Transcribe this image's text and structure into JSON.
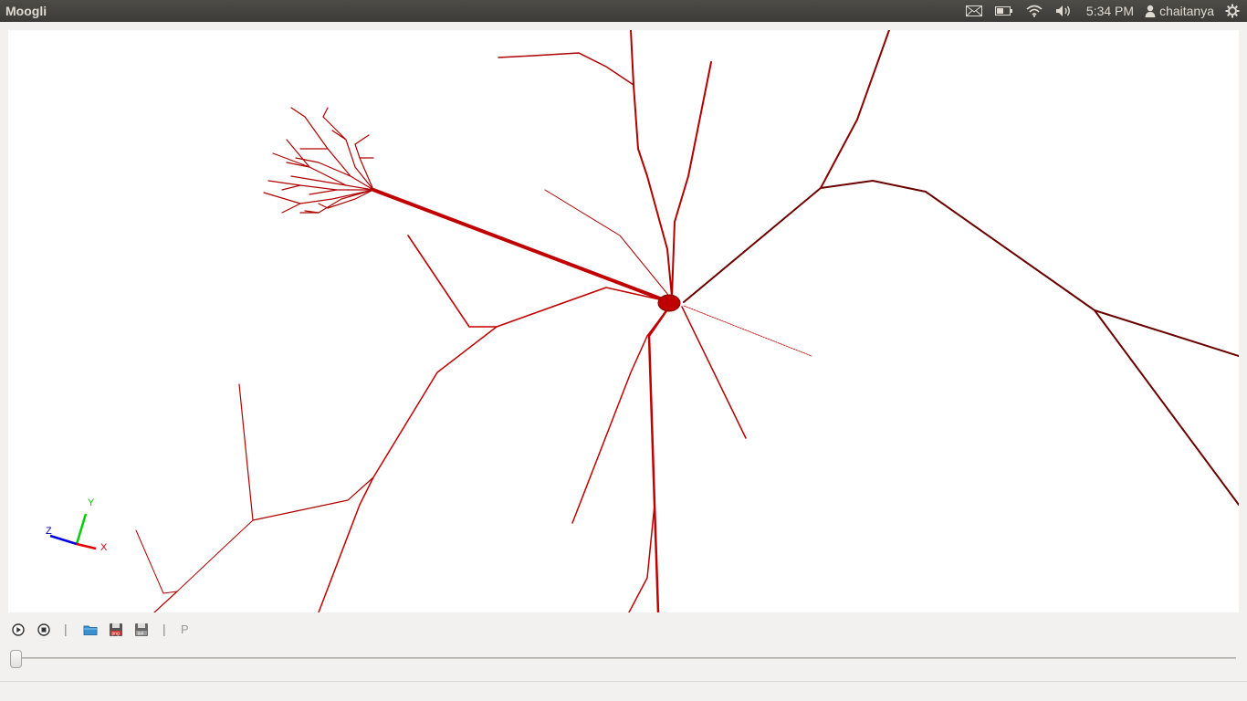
{
  "window": {
    "title": "Moogli"
  },
  "indicators": {
    "mail_icon": "envelope-icon",
    "battery_icon": "battery-icon",
    "wifi_icon": "wifi-icon",
    "sound_icon": "speaker-icon",
    "clock": "5:34 PM",
    "user_icon": "user-icon",
    "username": "chaitanya",
    "settings_icon": "gear-icon"
  },
  "axes_widget": {
    "y_label": "Y",
    "z_label": "Z",
    "x_label": "X"
  },
  "toolbar": {
    "play_icon": "play-icon",
    "stop_icon": "stop-icon",
    "separator": "|",
    "open_icon": "folder-open-icon",
    "save_png_icon": "save-png-icon",
    "save_avi_icon": "save-avi-icon",
    "save_png_tag": "png",
    "save_avi_tag": "avi",
    "p_label": "P"
  },
  "slider": {
    "value": 0
  },
  "colors": {
    "neuron": "#c00000",
    "neuron_dark": "#6a0000",
    "viewport_bg": "#ffffff"
  }
}
